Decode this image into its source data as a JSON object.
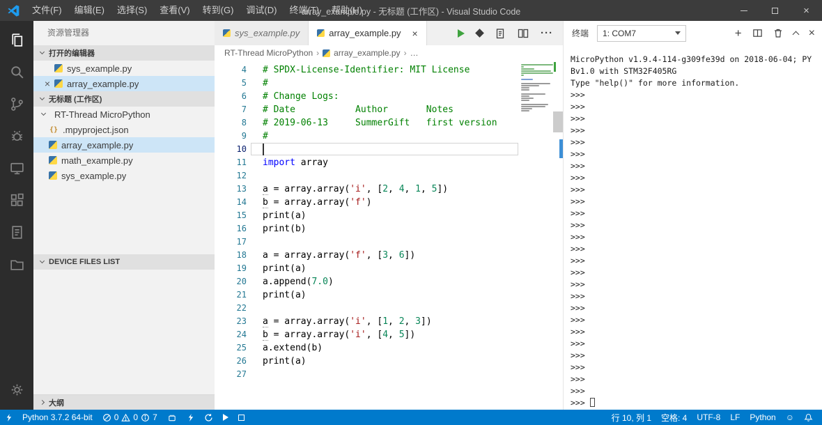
{
  "titlebar": {
    "menus": [
      "文件(F)",
      "编辑(E)",
      "选择(S)",
      "查看(V)",
      "转到(G)",
      "调试(D)",
      "终端(T)",
      "帮助(H)"
    ],
    "title": "array_example.py - 无标题 (工作区) - Visual Studio Code"
  },
  "icons": {
    "close": "×",
    "more": "···",
    "plus": "+",
    "smiley": "☺",
    "braces": "{}",
    "breadcrumb_sep": "›"
  },
  "sidebar": {
    "title": "资源管理器",
    "sections": {
      "open_editors": "打开的编辑器",
      "workspace": "无标题 (工作区)",
      "device_files": "DEVICE FILES LIST",
      "outline": "大纲"
    },
    "open_editors": [
      {
        "name": "sys_example.py",
        "selected": false
      },
      {
        "name": "array_example.py",
        "selected": true
      }
    ],
    "tree": {
      "folder": "RT-Thread MicroPython",
      "children": [
        {
          "name": ".mpyproject.json",
          "icon": "json",
          "selected": false
        },
        {
          "name": "array_example.py",
          "icon": "python",
          "selected": true
        },
        {
          "name": "math_example.py",
          "icon": "python",
          "selected": false
        },
        {
          "name": "sys_example.py",
          "icon": "python",
          "selected": false
        }
      ]
    }
  },
  "editor": {
    "tabs": [
      {
        "label": "sys_example.py",
        "active": false,
        "preview": true
      },
      {
        "label": "array_example.py",
        "active": true,
        "preview": false
      }
    ],
    "breadcrumb": [
      "RT-Thread MicroPython",
      "array_example.py",
      "…"
    ],
    "code": {
      "first_line": 4,
      "cursor_line": 10,
      "lines": [
        {
          "n": 4,
          "t": [
            [
              "cm",
              "# SPDX-License-Identifier: MIT License"
            ]
          ]
        },
        {
          "n": 5,
          "t": [
            [
              "cm",
              "#"
            ]
          ]
        },
        {
          "n": 6,
          "t": [
            [
              "cm",
              "# Change Logs:"
            ]
          ]
        },
        {
          "n": 7,
          "t": [
            [
              "cm",
              "# Date           Author       Notes"
            ]
          ]
        },
        {
          "n": 8,
          "t": [
            [
              "cm",
              "# 2019-06-13     SummerGift   first version"
            ]
          ]
        },
        {
          "n": 9,
          "t": [
            [
              "cm",
              "#"
            ]
          ]
        },
        {
          "n": 10,
          "t": []
        },
        {
          "n": 11,
          "t": [
            [
              "kw",
              "import"
            ],
            [
              "t",
              " array"
            ]
          ]
        },
        {
          "n": 12,
          "t": []
        },
        {
          "n": 13,
          "t": [
            [
              "tu",
              "a"
            ],
            [
              "t",
              " = array.array("
            ],
            [
              "s",
              "'i'"
            ],
            [
              "t",
              ", ["
            ],
            [
              "n",
              "2"
            ],
            [
              "t",
              ", "
            ],
            [
              "n",
              "4"
            ],
            [
              "t",
              ", "
            ],
            [
              "n",
              "1"
            ],
            [
              "t",
              ", "
            ],
            [
              "n",
              "5"
            ],
            [
              "t",
              "])"
            ]
          ]
        },
        {
          "n": 14,
          "t": [
            [
              "tu",
              "b"
            ],
            [
              "t",
              " = array.array("
            ],
            [
              "s",
              "'f'"
            ],
            [
              "t",
              ")"
            ]
          ]
        },
        {
          "n": 15,
          "t": [
            [
              "t",
              "print(a)"
            ]
          ]
        },
        {
          "n": 16,
          "t": [
            [
              "t",
              "print(b)"
            ]
          ]
        },
        {
          "n": 17,
          "t": []
        },
        {
          "n": 18,
          "t": [
            [
              "t",
              "a = array.array("
            ],
            [
              "s",
              "'f'"
            ],
            [
              "t",
              ", ["
            ],
            [
              "n",
              "3"
            ],
            [
              "t",
              ", "
            ],
            [
              "n",
              "6"
            ],
            [
              "t",
              "])"
            ]
          ]
        },
        {
          "n": 19,
          "t": [
            [
              "t",
              "print(a)"
            ]
          ]
        },
        {
          "n": 20,
          "t": [
            [
              "t",
              "a.append("
            ],
            [
              "n",
              "7.0"
            ],
            [
              "t",
              ")"
            ]
          ]
        },
        {
          "n": 21,
          "t": [
            [
              "t",
              "print(a)"
            ]
          ]
        },
        {
          "n": 22,
          "t": []
        },
        {
          "n": 23,
          "t": [
            [
              "tu",
              "a"
            ],
            [
              "t",
              " = array.array("
            ],
            [
              "s",
              "'i'"
            ],
            [
              "t",
              ", ["
            ],
            [
              "n",
              "1"
            ],
            [
              "t",
              ", "
            ],
            [
              "n",
              "2"
            ],
            [
              "t",
              ", "
            ],
            [
              "n",
              "3"
            ],
            [
              "t",
              "])"
            ]
          ]
        },
        {
          "n": 24,
          "t": [
            [
              "tu",
              "b"
            ],
            [
              "t",
              " = array.array("
            ],
            [
              "s",
              "'i'"
            ],
            [
              "t",
              ", ["
            ],
            [
              "n",
              "4"
            ],
            [
              "t",
              ", "
            ],
            [
              "n",
              "5"
            ],
            [
              "t",
              "])"
            ]
          ]
        },
        {
          "n": 25,
          "t": [
            [
              "t",
              "a.extend(b)"
            ]
          ]
        },
        {
          "n": 26,
          "t": [
            [
              "t",
              "print(a)"
            ]
          ]
        },
        {
          "n": 27,
          "t": []
        }
      ]
    }
  },
  "terminal": {
    "label": "终端",
    "selector": "1: COM7",
    "banner": [
      "MicroPython v1.9.4-114-g309fe39d on 2018-06-04; PY",
      "Bv1.0 with STM32F405RG",
      "Type \"help()\" for more information."
    ],
    "prompt": ">>>",
    "prompt_count": 26,
    "cursor_prompt": ">>> "
  },
  "statusbar": {
    "interpreter": "Python 3.7.2 64-bit",
    "errors": "0",
    "warnings": "0",
    "infos": "7",
    "line_col": "行 10, 列 1",
    "indent": "空格: 4",
    "encoding": "UTF-8",
    "eol": "LF",
    "language": "Python"
  },
  "colors": {
    "statusbar": "#007acc",
    "comment": "#008000",
    "keyword": "#0000ff",
    "string": "#a31515",
    "number": "#098658",
    "selection": "#cde5f7"
  }
}
